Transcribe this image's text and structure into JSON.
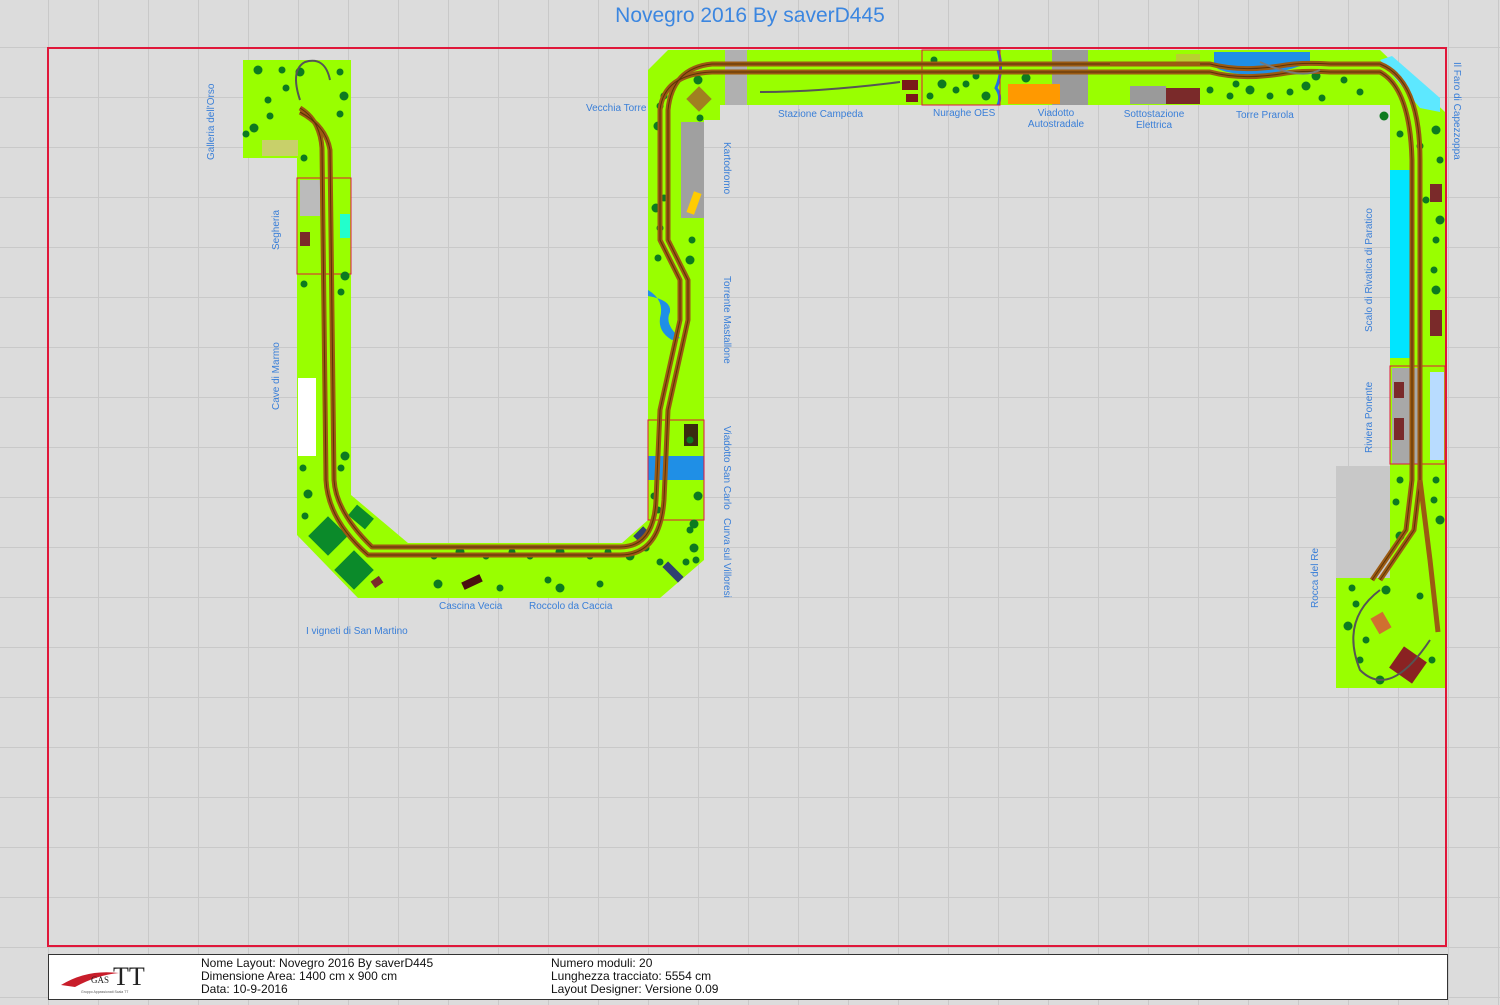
{
  "title": "Novegro 2016 By saverD445",
  "labels": {
    "galleria": "Galleria dell'Orso",
    "segheria": "Segheria",
    "cave": "Cave di Marmo",
    "vigneti": "I vigneti di San Martino",
    "cascina": "Cascina Vecia",
    "roccolo": "Roccolo da Caccia",
    "vecchia_torre": "Vecchia Torre",
    "kartodromo": "Kartodromo",
    "torrente": "Torrente Mastallone",
    "viadotto_sancarlo": "Viadotto San Carlo",
    "curva_villoresi": "Curva sul Villoresi",
    "stazione": "Stazione Campeda",
    "nuraghe": "Nuraghe OES",
    "viadotto_auto": "Viadotto\nAutostradale",
    "sottostazione": "Sottostazione\nElettrica",
    "torre_prarola": "Torre Prarola",
    "faro": "Il Faro di Capezzoppa",
    "scalo": "Scalo di Rivatica di Paratico",
    "riviera": "Riviera Ponente",
    "rocca": "Rocca del Re"
  },
  "footer": {
    "logo_text": "GAS TT",
    "logo_sub": "Gruppo Appassionati Scala TT",
    "nome_layout": "Nome Layout: Novegro 2016 By saverD445",
    "dimensione": "Dimensione Area: 1400 cm x 900 cm",
    "data": "Data: 10-9-2016",
    "numero_moduli": "Numero moduli: 20",
    "lunghezza": "Lunghezza tracciato: 5554 cm",
    "designer": "Layout Designer: Versione 0.09"
  },
  "colors": {
    "module": "#99ff00",
    "track": "#9b5a12",
    "title": "#3b86e0",
    "border": "#e0173a",
    "water": "#1f8fe6",
    "tree": "#0d7a20"
  }
}
